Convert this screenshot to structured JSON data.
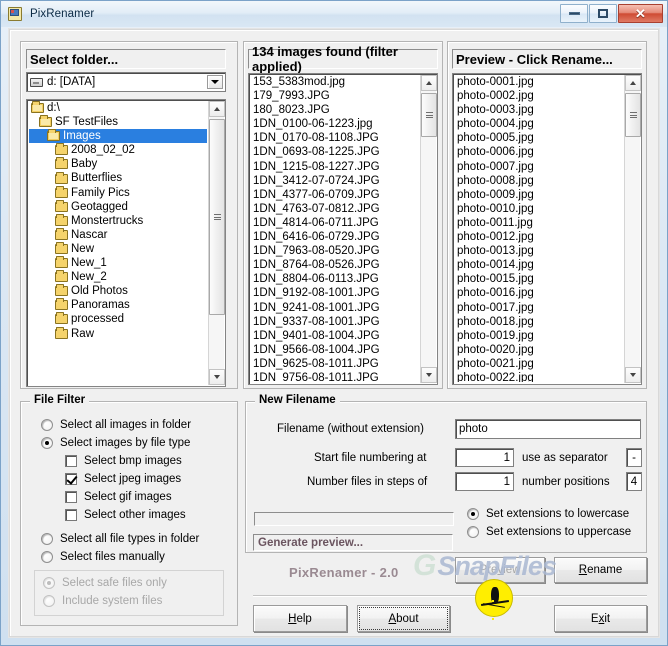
{
  "window": {
    "title": "PixRenamer",
    "icon": "app-icon",
    "minimize_label": "Minimize",
    "maximize_label": "Maximize",
    "close_label": "Close"
  },
  "folder_panel": {
    "header": "Select folder...",
    "drive_combo": {
      "value": "d: [DATA]",
      "icon": "drive-icon"
    },
    "tree": [
      {
        "label": "d:\\",
        "indent": 0,
        "type": "open",
        "selected": false
      },
      {
        "label": "SF TestFiles",
        "indent": 1,
        "type": "open",
        "selected": false
      },
      {
        "label": "Images",
        "indent": 2,
        "type": "open",
        "selected": true
      },
      {
        "label": "2008_02_02",
        "indent": 3,
        "type": "closed",
        "selected": false
      },
      {
        "label": "Baby",
        "indent": 3,
        "type": "closed",
        "selected": false
      },
      {
        "label": "Butterflies",
        "indent": 3,
        "type": "closed",
        "selected": false
      },
      {
        "label": "Family Pics",
        "indent": 3,
        "type": "closed",
        "selected": false
      },
      {
        "label": "Geotagged",
        "indent": 3,
        "type": "closed",
        "selected": false
      },
      {
        "label": "Monstertrucks",
        "indent": 3,
        "type": "closed",
        "selected": false
      },
      {
        "label": "Nascar",
        "indent": 3,
        "type": "closed",
        "selected": false
      },
      {
        "label": "New",
        "indent": 3,
        "type": "closed",
        "selected": false
      },
      {
        "label": "New_1",
        "indent": 3,
        "type": "closed",
        "selected": false
      },
      {
        "label": "New_2",
        "indent": 3,
        "type": "closed",
        "selected": false
      },
      {
        "label": "Old Photos",
        "indent": 3,
        "type": "closed",
        "selected": false
      },
      {
        "label": "Panoramas",
        "indent": 3,
        "type": "closed",
        "selected": false
      },
      {
        "label": "processed",
        "indent": 3,
        "type": "closed",
        "selected": false
      },
      {
        "label": "Raw",
        "indent": 3,
        "type": "closed",
        "selected": false
      }
    ]
  },
  "files_panel": {
    "header": "134 images found (filter applied)",
    "items": [
      "153_5383mod.jpg",
      "179_7993.JPG",
      "180_8023.JPG",
      "1DN_0100-06-1223.jpg",
      "1DN_0170-08-1108.JPG",
      "1DN_0693-08-1225.JPG",
      "1DN_1215-08-1227.JPG",
      "1DN_3412-07-0724.JPG",
      "1DN_4377-06-0709.JPG",
      "1DN_4763-07-0812.JPG",
      "1DN_4814-06-0711.JPG",
      "1DN_6416-06-0729.JPG",
      "1DN_7963-08-0520.JPG",
      "1DN_8764-08-0526.JPG",
      "1DN_8804-06-0113.JPG",
      "1DN_9192-08-1001.JPG",
      "1DN_9241-08-1001.JPG",
      "1DN_9337-08-1001.JPG",
      "1DN_9401-08-1004.JPG",
      "1DN_9566-08-1004.JPG",
      "1DN_9625-08-1011.JPG",
      "1DN_9756-08-1011.JPG"
    ]
  },
  "preview_panel": {
    "header": "Preview - Click Rename...",
    "items": [
      "photo-0001.jpg",
      "photo-0002.jpg",
      "photo-0003.jpg",
      "photo-0004.jpg",
      "photo-0005.jpg",
      "photo-0006.jpg",
      "photo-0007.jpg",
      "photo-0008.jpg",
      "photo-0009.jpg",
      "photo-0010.jpg",
      "photo-0011.jpg",
      "photo-0012.jpg",
      "photo-0013.jpg",
      "photo-0014.jpg",
      "photo-0015.jpg",
      "photo-0016.jpg",
      "photo-0017.jpg",
      "photo-0018.jpg",
      "photo-0019.jpg",
      "photo-0020.jpg",
      "photo-0021.jpg",
      "photo-0022.jpg"
    ]
  },
  "file_filter": {
    "title": "File Filter",
    "options": [
      {
        "label": "Select all images in folder",
        "checked": false
      },
      {
        "label": "Select images by file type",
        "checked": true
      }
    ],
    "types": [
      {
        "label": "Select bmp images",
        "checked": false
      },
      {
        "label": "Select jpeg images",
        "checked": true
      },
      {
        "label": "Select gif images",
        "checked": false
      },
      {
        "label": "Select other images",
        "checked": false
      }
    ],
    "options2": [
      {
        "label": "Select all file types in folder",
        "checked": false
      },
      {
        "label": "Select files manually",
        "checked": false
      }
    ],
    "safety": [
      {
        "label": "Select safe files only",
        "checked": true,
        "disabled": true
      },
      {
        "label": "Include system files",
        "checked": false,
        "disabled": true
      }
    ]
  },
  "new_filename": {
    "title": "New Filename",
    "filename_label": "Filename (without extension)",
    "filename_value": "photo",
    "start_label": "Start file numbering at",
    "start_value": "1",
    "separator_label": "use as separator",
    "separator_value": "-",
    "steps_label": "Number files in steps of",
    "steps_value": "1",
    "positions_label": "number positions",
    "positions_value": "4",
    "case_options": [
      {
        "label": "Set extensions to lowercase",
        "checked": true
      },
      {
        "label": "Set extensions to uppercase",
        "checked": false
      }
    ],
    "status_text": "Generate preview...",
    "version_label": "PixRenamer - 2.0"
  },
  "buttons": {
    "preview": "Preview",
    "preview_accel": "v",
    "rename": "Rename",
    "rename_accel": "R",
    "help": "Help",
    "help_accel": "H",
    "about": "About",
    "about_accel": "A",
    "exit": "Exit",
    "exit_accel": "x"
  },
  "watermark": {
    "g": "G",
    "text": "SnapFiles"
  },
  "colors": {
    "selection": "#2a7fe0",
    "logo_yellow": "#ffee00",
    "titlebar": "#dce8f4",
    "close_button": "#cf4b33",
    "face": "#f0f0f0"
  }
}
